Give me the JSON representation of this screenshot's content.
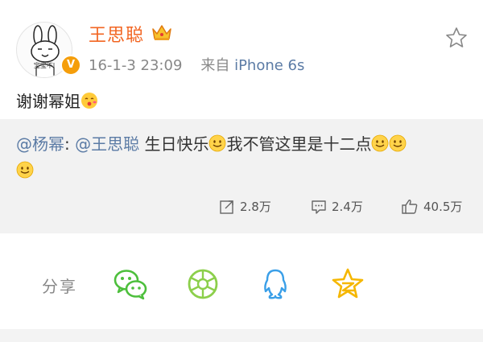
{
  "post": {
    "username": "王思聪",
    "avatar_caption": "宝宝不l",
    "verified_mark": "V",
    "date": "16-1-3 23:09",
    "source_prefix": "来自",
    "source_device": "iPhone 6s",
    "text": "谢谢幂姐",
    "icons": [
      "crown-icon",
      "star-icon",
      "kiss-emoji-icon"
    ]
  },
  "repost": {
    "mention1": "@杨幂",
    "colon": ": ",
    "mention2": "@王思聪",
    "text1": " 生日快乐",
    "text2": "我不管这里是十二点",
    "icons": [
      "smile-emoji-icon"
    ]
  },
  "stats": {
    "repost_count": "2.8万",
    "comment_count": "2.4万",
    "like_count": "40.5万"
  },
  "share": {
    "label": "分享",
    "targets": [
      "wechat-icon",
      "moments-icon",
      "qq-icon",
      "qzone-icon"
    ]
  },
  "colors": {
    "username": "#f26522",
    "mention": "#5b7ba5",
    "repost_bg": "#f2f2f2",
    "wechat": "#4dbf3c",
    "moments": "#8ccf4b",
    "qq": "#3a9fe8",
    "qzone": "#f5b700"
  }
}
